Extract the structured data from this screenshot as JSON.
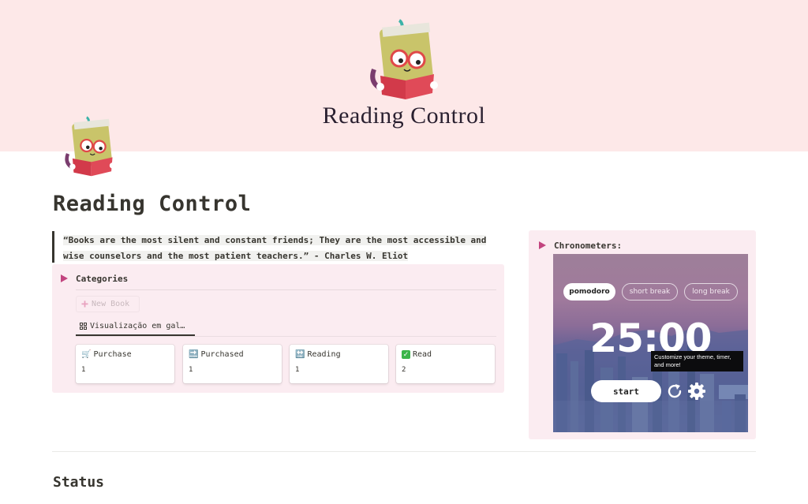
{
  "cover": {
    "logo": "book-mascot-icon",
    "title": "Reading Control",
    "background_color": "#fde8e8"
  },
  "page": {
    "icon": "book-mascot-icon",
    "title": "Reading Control"
  },
  "quote": {
    "line1": "“Books are the most silent and constant friends; They are the most accessible and",
    "line2": "wise counselors and the most patient teachers.” - Charles W. Eliot"
  },
  "categories": {
    "heading": "Categories",
    "new_button_label": "New Book",
    "view_tab_label": "Visualização em gal…",
    "cards": [
      {
        "icon": "shopping-cart-icon",
        "emoji": "🛒",
        "label": "Purchase",
        "count": "1"
      },
      {
        "icon": "soon-arrow-icon",
        "emoji": "🔜",
        "label": "Purchased",
        "count": "1"
      },
      {
        "icon": "on-arrow-icon",
        "emoji": "🔛",
        "label": "Reading",
        "count": "1"
      },
      {
        "icon": "check-mark-icon",
        "emoji": "✓",
        "label": "Read",
        "count": "2"
      }
    ]
  },
  "chronometers": {
    "heading": "Chronometers:",
    "modes": [
      {
        "label": "pomodoro",
        "active": true
      },
      {
        "label": "short break",
        "active": false
      },
      {
        "label": "long break",
        "active": false
      }
    ],
    "timer": "25:00",
    "tooltip": "Customize your theme, timer, and more!",
    "start_label": "start"
  },
  "status": {
    "heading": "Status"
  },
  "colors": {
    "accent": "#c2447f",
    "callout_bg": "#fbecf1",
    "text": "#37352f"
  }
}
